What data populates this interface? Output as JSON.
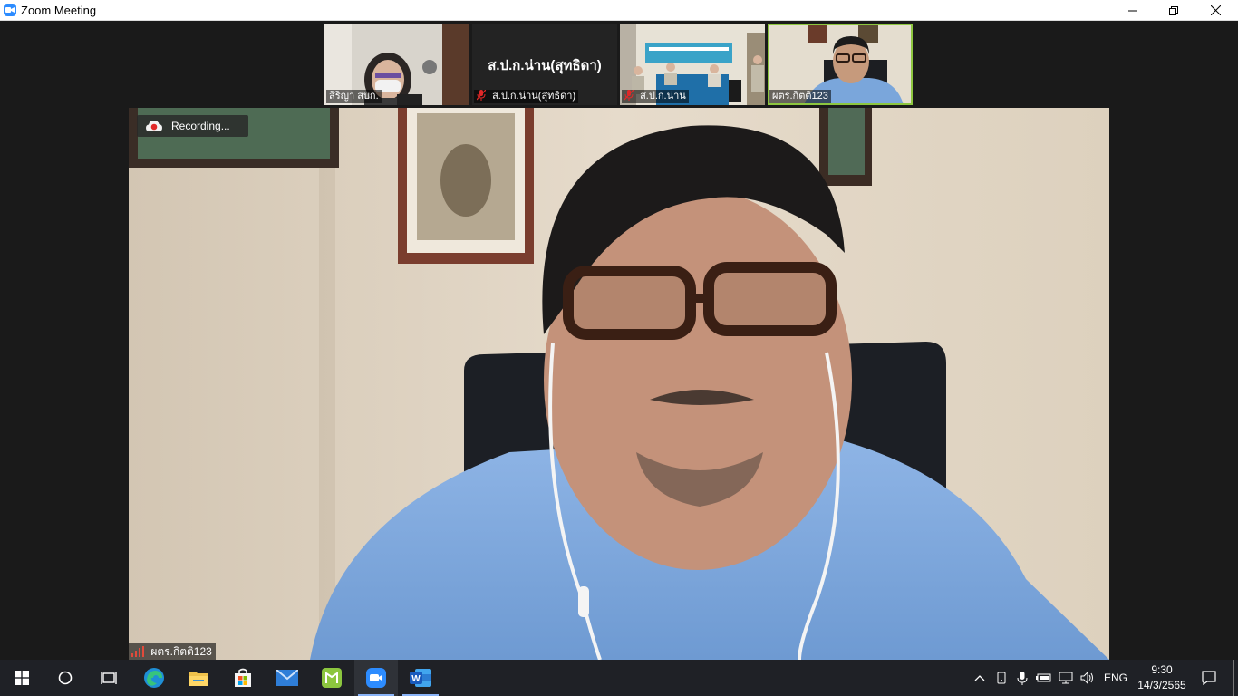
{
  "window": {
    "title": "Zoom Meeting",
    "colors": {
      "zoom_blue": "#2D8CFF",
      "active_speaker_border": "#8dc63f",
      "recording_red": "#e02828"
    }
  },
  "gallery": [
    {
      "name": "สิริญา สบก.",
      "muted": false,
      "active": false,
      "icon": "person-video"
    },
    {
      "name": "ส.ป.ก.น่าน(สุทธิดา)",
      "display_name": "ส.ป.ก.น่าน(สุทธิดา)",
      "muted": true,
      "active": false,
      "icon": "video-off"
    },
    {
      "name": "ส.ป.ก.น่าน",
      "muted": true,
      "active": false,
      "icon": "meeting-room-video"
    },
    {
      "name": "ผตร.กิตติ123",
      "muted": false,
      "active": true,
      "icon": "person-video"
    }
  ],
  "main": {
    "recording_label": "Recording...",
    "speaker_name": "ผตร.กิตติ123"
  },
  "taskbar": {
    "items": [
      "start-icon",
      "search-icon",
      "task-view-icon",
      "edge-icon",
      "file-explorer-icon",
      "store-icon",
      "mail-icon",
      "green-app-icon",
      "zoom-icon",
      "word-icon"
    ],
    "tray": {
      "language": "ENG",
      "time": "9:30",
      "date": "14/3/2565"
    }
  }
}
